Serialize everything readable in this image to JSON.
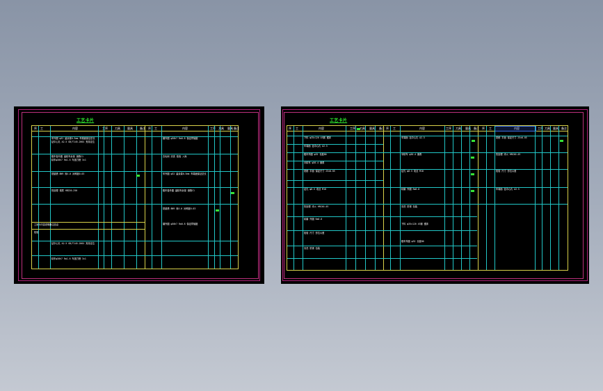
{
  "left_sheet": {
    "title": "工艺卡片",
    "header": [
      "序",
      "工",
      "内容",
      "工序",
      "刀具",
      "量具",
      "备注",
      "序",
      "工",
      "内容",
      "工序",
      "刀具",
      "量具",
      "备注"
    ],
    "note_line": "工序卡内容说明备注信息",
    "section_label": "检验",
    "rows": [
      "车外圆 φ32 留余量0.5mm 车端面保证总长",
      "钻中心孔 A2.5 GB/T145-2001 夹持定位",
      "粗车各外圆 留精车余量 倒角C1",
      "精车φ30h7 Ra1.6 车退刀槽 3×1",
      "铣键槽 8N9 深4.0 对称度0.03",
      "热处理 调质 HB220-250",
      "磨外圆 φ30h7 Ra0.8 保证同轴度",
      "去毛刺 清洗 检验 入库"
    ]
  },
  "right_sheet": {
    "title": "工艺卡片",
    "header": [
      "序",
      "工",
      "内容",
      "工序",
      "刀具",
      "量具",
      "备注",
      "序",
      "工",
      "内容",
      "工序",
      "刀具",
      "量具",
      "备注",
      "序",
      "工",
      "内容",
      "工序",
      "刀具",
      "量具",
      "备注"
    ],
    "rows": [
      "下料 φ35×120 45钢 锯床",
      "车端面 钻中心孔 A2.5",
      "粗车外圆 φ32 长度80",
      "半精车 φ30.4 倒角",
      "铣削 平面 保证尺寸 25±0.05",
      "钻孔 φ8.5 攻丝 M10",
      "热处理 淬火 HRC40-45",
      "精磨 外圆 Ra0.8",
      "检验 尺寸 形位公差",
      "清洗 防锈 包装"
    ]
  }
}
